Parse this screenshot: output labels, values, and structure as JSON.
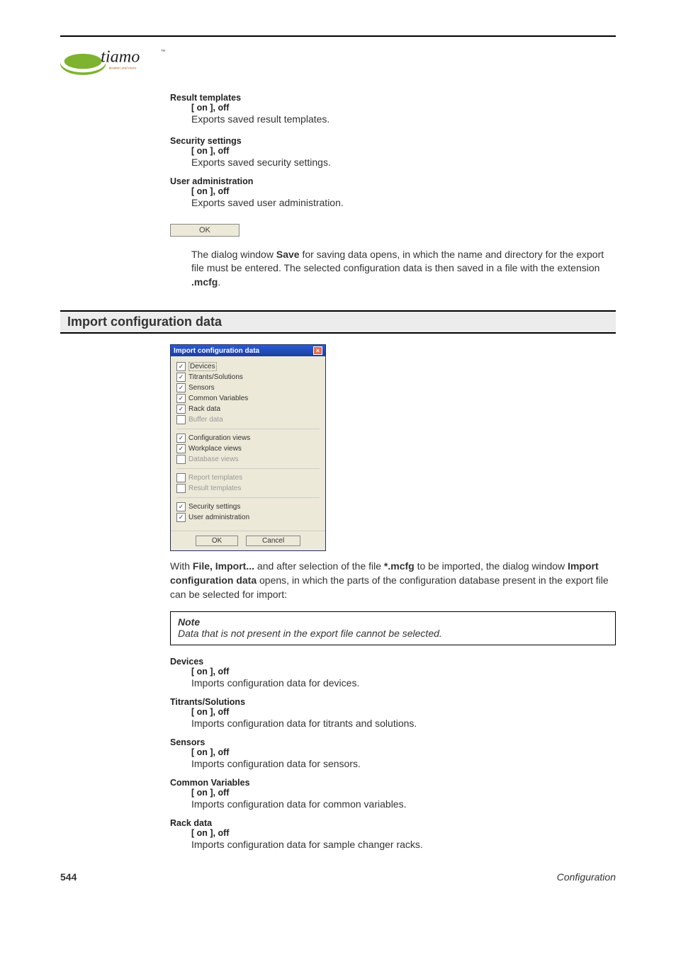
{
  "logo_alt": "tiamo — titration and more",
  "top": {
    "items": [
      {
        "heading": "Result templates",
        "option": "[ on ], off",
        "desc": "Exports saved result templates."
      },
      {
        "heading": "Security settings",
        "option": "[ on ], off",
        "desc": "Exports saved security settings."
      },
      {
        "heading": "User administration",
        "option": "[ on ], off",
        "desc": "Exports saved user administration."
      }
    ],
    "ok_label": "OK",
    "para_pre": "The dialog window ",
    "para_bold1": "Save",
    "para_mid": " for saving data opens, in which the name and directory for the export file must be entered. The selected configuration data is then saved in a file with the extension ",
    "para_bold2": ".mcfg",
    "para_end": "."
  },
  "section_title": "Import configuration data",
  "dialog": {
    "title": "Import configuration data",
    "close": "×",
    "groups": [
      [
        {
          "label": "Devices",
          "checked": true,
          "selected": true
        },
        {
          "label": "Titrants/Solutions",
          "checked": true
        },
        {
          "label": "Sensors",
          "checked": true
        },
        {
          "label": "Common Variables",
          "checked": true
        },
        {
          "label": "Rack data",
          "checked": true
        },
        {
          "label": "Buffer data",
          "checked": false,
          "disabled": true
        }
      ],
      [
        {
          "label": "Configuration views",
          "checked": true
        },
        {
          "label": "Workplace views",
          "checked": true
        },
        {
          "label": "Database views",
          "checked": false,
          "disabled": true
        }
      ],
      [
        {
          "label": "Report templates",
          "checked": false,
          "disabled": true
        },
        {
          "label": "Result templates",
          "checked": false,
          "disabled": true
        }
      ],
      [
        {
          "label": "Security settings",
          "checked": true
        },
        {
          "label": "User administration",
          "checked": true
        }
      ]
    ],
    "ok": "OK",
    "cancel": "Cancel"
  },
  "import_para": {
    "pre": "With ",
    "b1": "File, Import...",
    "mid1": " and after selection of the file ",
    "b2": "*.mcfg",
    "mid2": " to be imported, the dialog window ",
    "b3": "Import configuration data",
    "end": " opens, in which the parts of the configuration database present in the export file can be selected for import:"
  },
  "note": {
    "title": "Note",
    "body": "Data that is not present in the export file cannot be selected."
  },
  "bottom": {
    "items": [
      {
        "heading": "Devices",
        "option": "[ on ], off",
        "desc": "Imports configuration data for devices."
      },
      {
        "heading": "Titrants/Solutions",
        "option": "[ on ], off",
        "desc": "Imports configuration data for titrants and solutions."
      },
      {
        "heading": "Sensors",
        "option": "[ on ], off",
        "desc": "Imports configuration data for sensors."
      },
      {
        "heading": "Common Variables",
        "option": "[ on ], off",
        "desc": "Imports configuration data for common variables."
      },
      {
        "heading": "Rack data",
        "option": "[ on ], off",
        "desc": "Imports configuration data for sample changer racks."
      }
    ]
  },
  "footer": {
    "page": "544",
    "section": "Configuration"
  }
}
